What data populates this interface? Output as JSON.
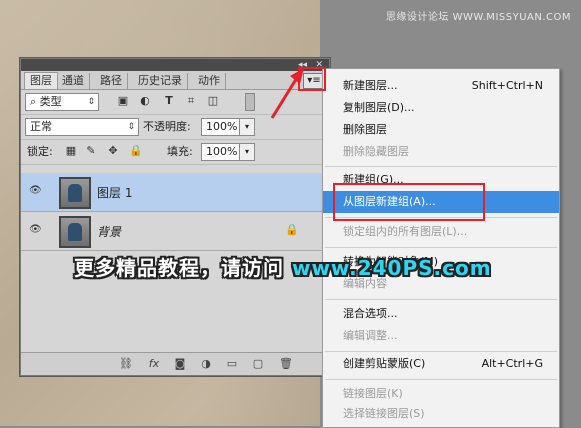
{
  "watermark": "思缘设计论坛 WWW.MISSYUAN.COM",
  "panel": {
    "collapse_glyph": "◂◂",
    "close_glyph": "✕",
    "tabs": [
      {
        "label": "图层",
        "active": true
      },
      {
        "label": "通道"
      },
      {
        "label": "路径"
      },
      {
        "label": "历史记录"
      },
      {
        "label": "动作"
      }
    ],
    "menu_button_glyph": "▾≡",
    "filter": {
      "kind_label": "类型",
      "search_glyph": "⌕"
    },
    "filter_icons": [
      "image-filter-icon",
      "adjustment-filter-icon",
      "type-filter-icon",
      "shape-filter-icon",
      "smart-object-filter-icon"
    ],
    "blend_mode": "正常",
    "opacity_label": "不透明度:",
    "opacity_value": "100%",
    "lock_label": "锁定:",
    "fill_label": "填充:",
    "fill_value": "100%",
    "layers": [
      {
        "name": "图层 1",
        "selected": true
      },
      {
        "name": "背景",
        "locked": true
      }
    ],
    "bottom_icons": [
      "link-layers-icon",
      "fx-icon",
      "layer-mask-icon",
      "adjustment-layer-icon",
      "new-group-icon",
      "new-layer-icon",
      "trash-icon"
    ]
  },
  "context_menu": {
    "items": [
      {
        "label": "新建图层...",
        "shortcut": "Shift+Ctrl+N"
      },
      {
        "label": "复制图层(D)..."
      },
      {
        "label": "删除图层"
      },
      {
        "label": "删除隐藏图层",
        "disabled": true
      },
      {
        "label": "新建组(G)..."
      },
      {
        "label": "从图层新建组(A)...",
        "highlighted": true
      },
      {
        "label": "锁定组内的所有图层(L)...",
        "disabled": true
      },
      {
        "label": "转换为智能对象(M)"
      },
      {
        "label": "编辑内容",
        "disabled": true
      },
      {
        "label": "混合选项..."
      },
      {
        "label": "编辑调整...",
        "disabled": true
      },
      {
        "label": "创建剪贴蒙版(C)",
        "shortcut": "Alt+Ctrl+G"
      },
      {
        "label": "链接图层(K)",
        "disabled": true
      },
      {
        "label": "选择链接图层(S)",
        "disabled": true
      }
    ]
  },
  "overlay": {
    "text": "更多精品教程，请访问",
    "url": "www.240PS.com"
  },
  "colors": {
    "highlight": "#3d8ee3",
    "annotation_red": "#e8202a",
    "overlay_url": "#2fd5f0"
  }
}
